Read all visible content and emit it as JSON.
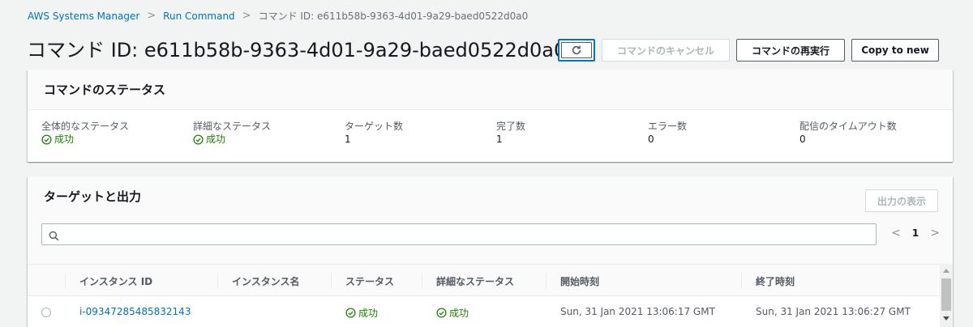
{
  "breadcrumb": {
    "items": [
      "AWS Systems Manager",
      "Run Command",
      "コマンド ID: e611b58b-9363-4d01-9a29-baed0522d0a0"
    ],
    "separator": ">"
  },
  "header": {
    "title": "コマンド ID: e611b58b-9363-4d01-9a29-baed0522d0a0",
    "actions": {
      "refresh_icon": "refresh-icon",
      "cancel_label": "コマンドのキャンセル",
      "rerun_label": "コマンドの再実行",
      "copy_label": "Copy to new"
    }
  },
  "status_panel": {
    "title": "コマンドのステータス",
    "fields": [
      {
        "key": "全体的なステータス",
        "value": "成功",
        "success": true
      },
      {
        "key": "詳細なステータス",
        "value": "成功",
        "success": true
      },
      {
        "key": "ターゲット数",
        "value": "1"
      },
      {
        "key": "完了数",
        "value": "1"
      },
      {
        "key": "エラー数",
        "value": "0"
      },
      {
        "key": "配信のタイムアウト数",
        "value": "0"
      }
    ]
  },
  "targets_panel": {
    "title": "ターゲットと出力",
    "show_output_label": "出力の表示",
    "search_placeholder": "",
    "pager": {
      "prev": "<",
      "page": "1",
      "next": ">"
    },
    "columns": [
      "インスタンス ID",
      "インスタンス名",
      "ステータス",
      "詳細なステータス",
      "開始時刻",
      "終了時刻"
    ],
    "rows": [
      {
        "instance_id": "i-09347285485832143",
        "instance_name": "",
        "status": "成功",
        "detailed_status": "成功",
        "start_time": "Sun, 31 Jan 2021 13:06:17 GMT",
        "end_time": "Sun, 31 Jan 2021 13:06:27 GMT"
      }
    ]
  },
  "colors": {
    "link": "#0073bb",
    "success": "#1d8102",
    "focus": "#0073bb"
  }
}
